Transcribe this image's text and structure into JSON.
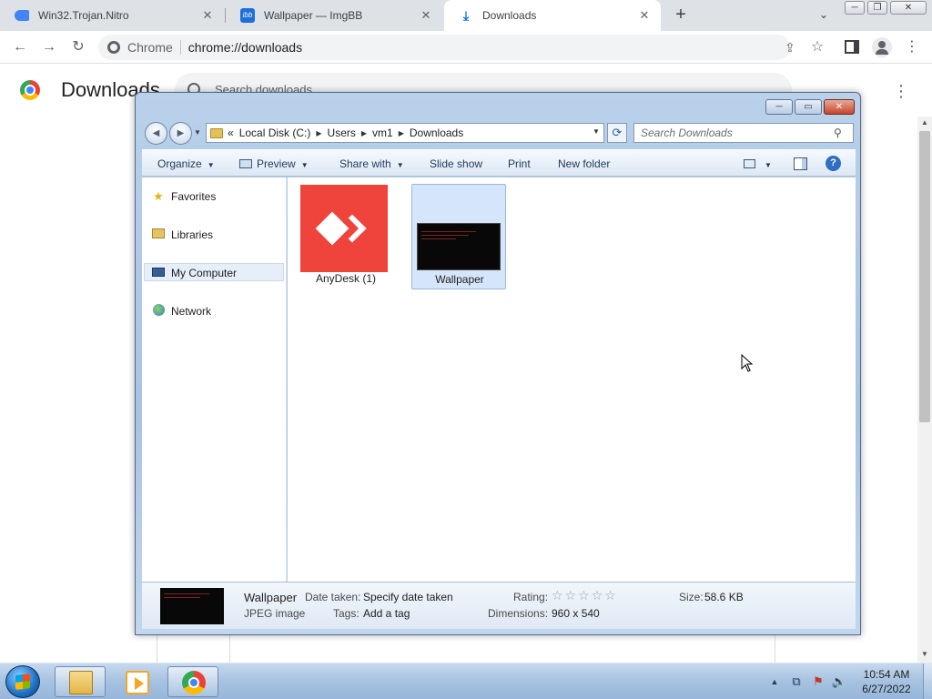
{
  "browser": {
    "tabs": [
      {
        "title": "Win32.Trojan.Nitro",
        "icon": "drive-icon"
      },
      {
        "title": "Wallpaper — ImgBB",
        "icon": "ibb-logo"
      },
      {
        "title": "Downloads",
        "icon": "download-icon"
      }
    ],
    "omnibox": {
      "site": "Chrome",
      "url": "chrome://downloads"
    }
  },
  "downloads_page": {
    "title": "Downloads",
    "search_placeholder": "Search downloads"
  },
  "explorer": {
    "breadcrumb": [
      "Local Disk (C:)",
      "Users",
      "vm1",
      "Downloads"
    ],
    "breadcrumb_prefix": "«",
    "search_placeholder": "Search Downloads",
    "commands": {
      "organize": "Organize",
      "preview": "Preview",
      "share_with": "Share with",
      "slide_show": "Slide show",
      "print": "Print",
      "new_folder": "New folder"
    },
    "nav": {
      "favorites": "Favorites",
      "libraries": "Libraries",
      "my_computer": "My Computer",
      "network": "Network"
    },
    "files": [
      {
        "name": "AnyDesk (1)",
        "type": "anydesk-app"
      },
      {
        "name": "Wallpaper",
        "type": "jpeg-image",
        "selected": true
      }
    ],
    "details": {
      "name": "Wallpaper",
      "type": "JPEG image",
      "date_taken_label": "Date taken:",
      "date_taken_value": "Specify date taken",
      "tags_label": "Tags:",
      "tags_value": "Add a tag",
      "rating_label": "Rating:",
      "rating_stars": "☆☆☆☆☆",
      "dimensions_label": "Dimensions:",
      "dimensions_value": "960 x 540",
      "size_label": "Size:",
      "size_value": "58.6 KB"
    }
  },
  "taskbar": {
    "clock_time": "10:54 AM",
    "clock_date": "6/27/2022"
  },
  "colors": {
    "anydesk_red": "#ef443b",
    "selection_blue": "#d6e6fa",
    "taskbar_blue": "#a6c2e0"
  }
}
